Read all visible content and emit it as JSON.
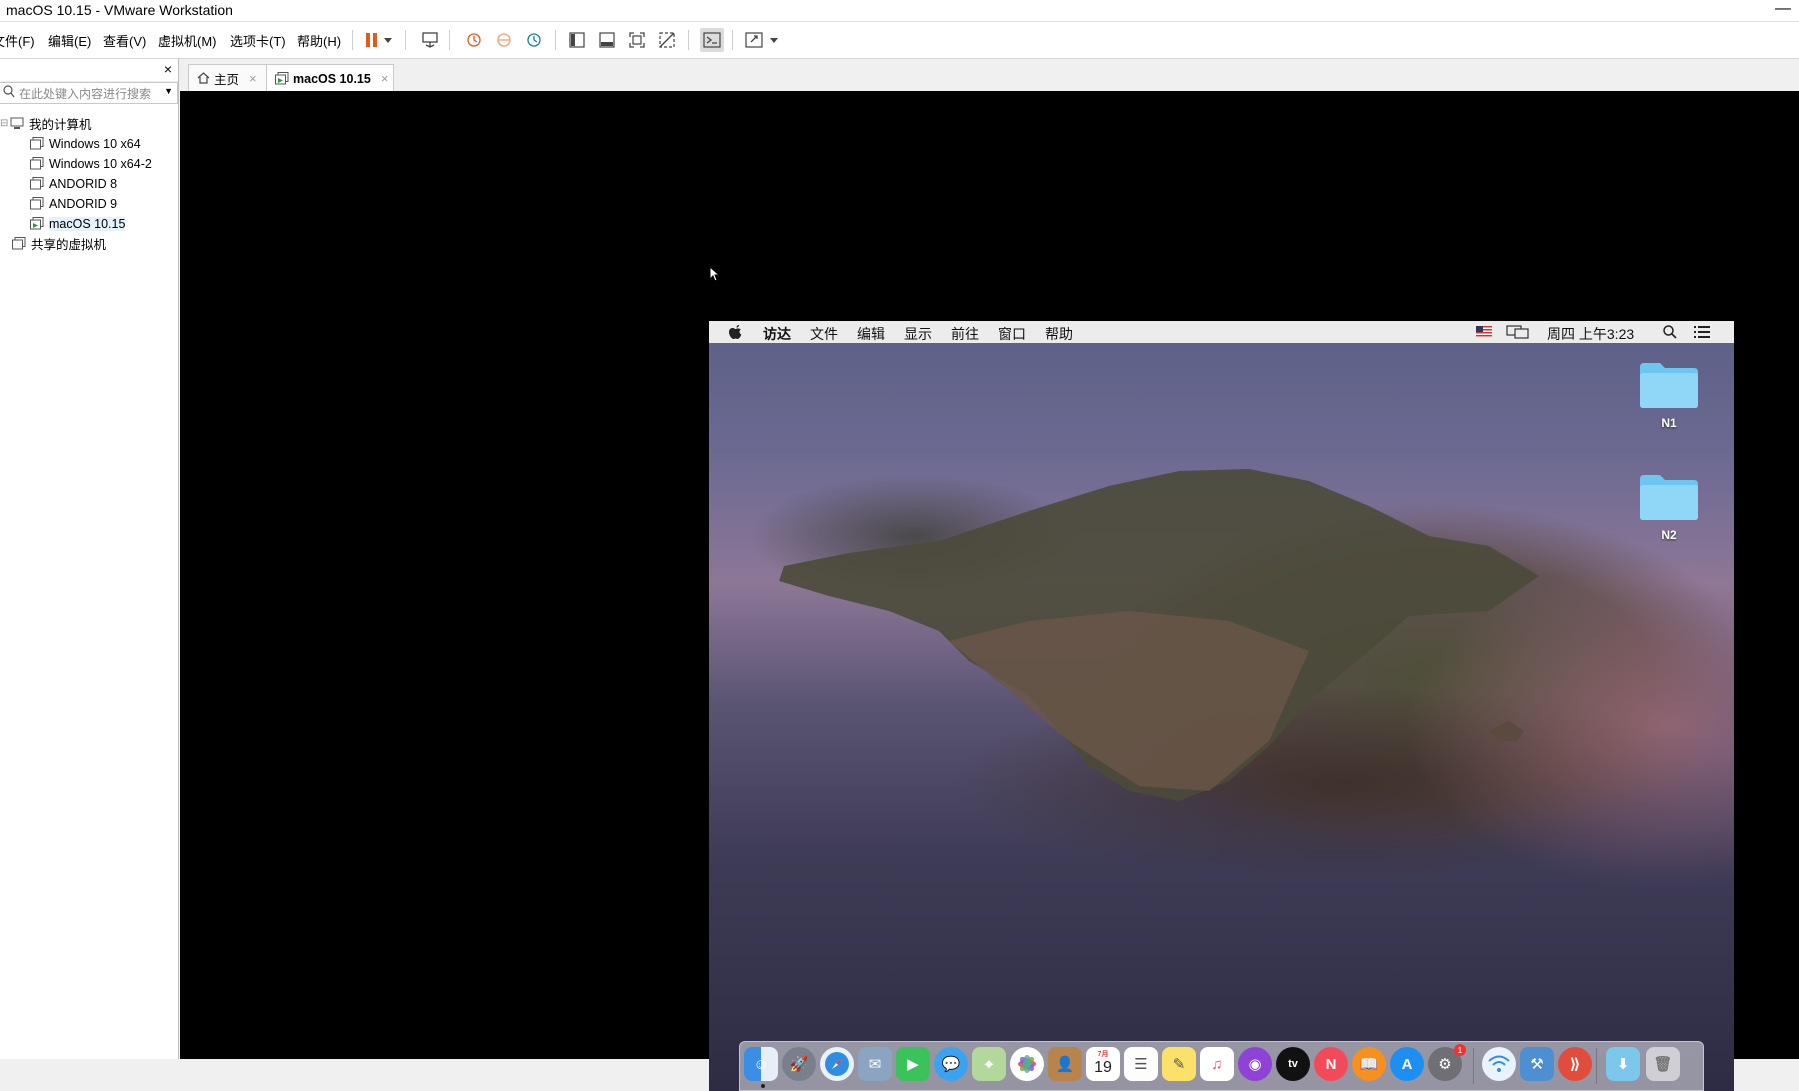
{
  "window": {
    "title": "macOS 10.15 - VMware Workstation",
    "minimize_glyph": "—"
  },
  "menubar": {
    "items": [
      {
        "label": "文件(F)"
      },
      {
        "label": "编辑(E)"
      },
      {
        "label": "查看(V)"
      },
      {
        "label": "虚拟机(M)"
      },
      {
        "label": "选项卡(T)"
      },
      {
        "label": "帮助(H)"
      }
    ]
  },
  "colors": {
    "pause": "#e35b1c",
    "accent_orange": "#f0a070",
    "teal": "#1a7f9c"
  },
  "sidebar": {
    "close_glyph": "×",
    "search_placeholder": "在此处键入内容进行搜索",
    "root": {
      "label": "我的计算机"
    },
    "vms": [
      {
        "label": "Windows 10 x64"
      },
      {
        "label": "Windows 10 x64-2"
      },
      {
        "label": "ANDORID 8"
      },
      {
        "label": "ANDORID 9"
      },
      {
        "label": "macOS 10.15"
      }
    ],
    "shared": {
      "label": "共享的虚拟机"
    }
  },
  "tabs": [
    {
      "label": "主页",
      "close": "×"
    },
    {
      "label": "macOS 10.15",
      "close": "×"
    }
  ],
  "mac": {
    "menu": [
      "访达",
      "文件",
      "编辑",
      "显示",
      "前往",
      "窗口",
      "帮助"
    ],
    "clock": "周四 上午3:23",
    "desktop_folders": [
      {
        "label": "N1"
      },
      {
        "label": "N2"
      }
    ],
    "dock": {
      "calendar_day": "19",
      "calendar_month": "7月",
      "tv_label": "tv",
      "badge": "1"
    }
  }
}
